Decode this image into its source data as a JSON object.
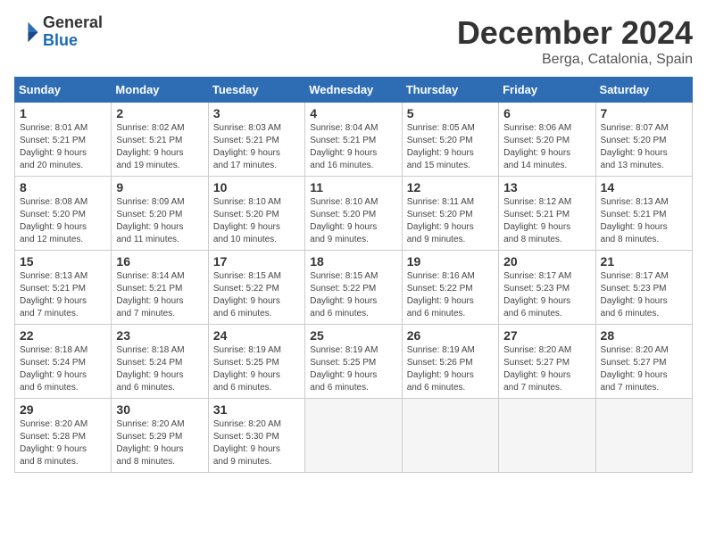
{
  "header": {
    "logo_general": "General",
    "logo_blue": "Blue",
    "month_title": "December 2024",
    "location": "Berga, Catalonia, Spain"
  },
  "days_of_week": [
    "Sunday",
    "Monday",
    "Tuesday",
    "Wednesday",
    "Thursday",
    "Friday",
    "Saturday"
  ],
  "weeks": [
    [
      {
        "day": 1,
        "sunrise": "8:01 AM",
        "sunset": "5:21 PM",
        "daylight": "9 hours and 20 minutes."
      },
      {
        "day": 2,
        "sunrise": "8:02 AM",
        "sunset": "5:21 PM",
        "daylight": "9 hours and 19 minutes."
      },
      {
        "day": 3,
        "sunrise": "8:03 AM",
        "sunset": "5:21 PM",
        "daylight": "9 hours and 17 minutes."
      },
      {
        "day": 4,
        "sunrise": "8:04 AM",
        "sunset": "5:21 PM",
        "daylight": "9 hours and 16 minutes."
      },
      {
        "day": 5,
        "sunrise": "8:05 AM",
        "sunset": "5:20 PM",
        "daylight": "9 hours and 15 minutes."
      },
      {
        "day": 6,
        "sunrise": "8:06 AM",
        "sunset": "5:20 PM",
        "daylight": "9 hours and 14 minutes."
      },
      {
        "day": 7,
        "sunrise": "8:07 AM",
        "sunset": "5:20 PM",
        "daylight": "9 hours and 13 minutes."
      }
    ],
    [
      {
        "day": 8,
        "sunrise": "8:08 AM",
        "sunset": "5:20 PM",
        "daylight": "9 hours and 12 minutes."
      },
      {
        "day": 9,
        "sunrise": "8:09 AM",
        "sunset": "5:20 PM",
        "daylight": "9 hours and 11 minutes."
      },
      {
        "day": 10,
        "sunrise": "8:10 AM",
        "sunset": "5:20 PM",
        "daylight": "9 hours and 10 minutes."
      },
      {
        "day": 11,
        "sunrise": "8:10 AM",
        "sunset": "5:20 PM",
        "daylight": "9 hours and 9 minutes."
      },
      {
        "day": 12,
        "sunrise": "8:11 AM",
        "sunset": "5:20 PM",
        "daylight": "9 hours and 9 minutes."
      },
      {
        "day": 13,
        "sunrise": "8:12 AM",
        "sunset": "5:21 PM",
        "daylight": "9 hours and 8 minutes."
      },
      {
        "day": 14,
        "sunrise": "8:13 AM",
        "sunset": "5:21 PM",
        "daylight": "9 hours and 8 minutes."
      }
    ],
    [
      {
        "day": 15,
        "sunrise": "8:13 AM",
        "sunset": "5:21 PM",
        "daylight": "9 hours and 7 minutes."
      },
      {
        "day": 16,
        "sunrise": "8:14 AM",
        "sunset": "5:21 PM",
        "daylight": "9 hours and 7 minutes."
      },
      {
        "day": 17,
        "sunrise": "8:15 AM",
        "sunset": "5:22 PM",
        "daylight": "9 hours and 6 minutes."
      },
      {
        "day": 18,
        "sunrise": "8:15 AM",
        "sunset": "5:22 PM",
        "daylight": "9 hours and 6 minutes."
      },
      {
        "day": 19,
        "sunrise": "8:16 AM",
        "sunset": "5:22 PM",
        "daylight": "9 hours and 6 minutes."
      },
      {
        "day": 20,
        "sunrise": "8:17 AM",
        "sunset": "5:23 PM",
        "daylight": "9 hours and 6 minutes."
      },
      {
        "day": 21,
        "sunrise": "8:17 AM",
        "sunset": "5:23 PM",
        "daylight": "9 hours and 6 minutes."
      }
    ],
    [
      {
        "day": 22,
        "sunrise": "8:18 AM",
        "sunset": "5:24 PM",
        "daylight": "9 hours and 6 minutes."
      },
      {
        "day": 23,
        "sunrise": "8:18 AM",
        "sunset": "5:24 PM",
        "daylight": "9 hours and 6 minutes."
      },
      {
        "day": 24,
        "sunrise": "8:19 AM",
        "sunset": "5:25 PM",
        "daylight": "9 hours and 6 minutes."
      },
      {
        "day": 25,
        "sunrise": "8:19 AM",
        "sunset": "5:25 PM",
        "daylight": "9 hours and 6 minutes."
      },
      {
        "day": 26,
        "sunrise": "8:19 AM",
        "sunset": "5:26 PM",
        "daylight": "9 hours and 6 minutes."
      },
      {
        "day": 27,
        "sunrise": "8:20 AM",
        "sunset": "5:27 PM",
        "daylight": "9 hours and 7 minutes."
      },
      {
        "day": 28,
        "sunrise": "8:20 AM",
        "sunset": "5:27 PM",
        "daylight": "9 hours and 7 minutes."
      }
    ],
    [
      {
        "day": 29,
        "sunrise": "8:20 AM",
        "sunset": "5:28 PM",
        "daylight": "9 hours and 8 minutes."
      },
      {
        "day": 30,
        "sunrise": "8:20 AM",
        "sunset": "5:29 PM",
        "daylight": "9 hours and 8 minutes."
      },
      {
        "day": 31,
        "sunrise": "8:20 AM",
        "sunset": "5:30 PM",
        "daylight": "9 hours and 9 minutes."
      },
      null,
      null,
      null,
      null
    ]
  ]
}
